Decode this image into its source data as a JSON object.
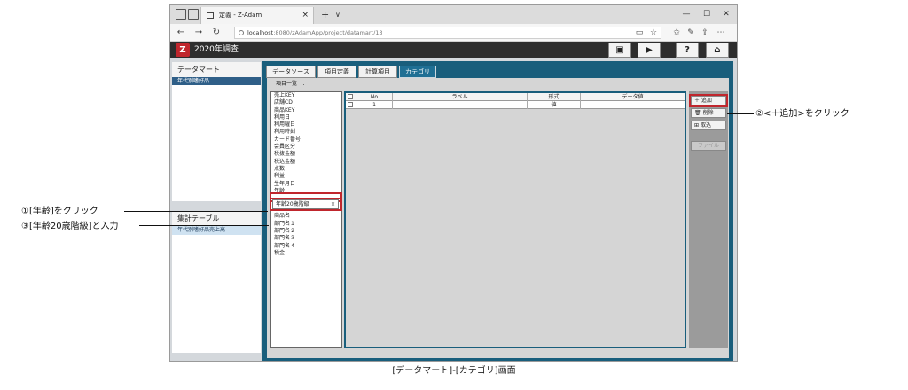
{
  "browser": {
    "tab_title": "定義 - Z-Adam",
    "url_host": "localhost",
    "url_rest": ":8080/zAdamApp/project/datamart/13"
  },
  "app": {
    "title": "2020年調査"
  },
  "left": {
    "datamart_header": "データマート",
    "datamart_selected": "年代別嗜好品",
    "summary_header": "集計テーブル",
    "summary_selected": "年代別嗜好品売上高"
  },
  "tabs": [
    {
      "label": "データソース"
    },
    {
      "label": "項目定義"
    },
    {
      "label": "計算項目"
    },
    {
      "label": "カテゴリ"
    }
  ],
  "content": {
    "list_header": "項目一覧　：",
    "fields": [
      "売上KEY",
      "店舗CD",
      "商品KEY",
      "利用日",
      "利用曜日",
      "利用時刻",
      "カード番号",
      "会員区分",
      "税抜金額",
      "税込金額",
      "点数",
      "利益",
      "生年月日",
      "年齢"
    ],
    "fields_after": [
      "階級",
      "商品名",
      "部門名１",
      "部門名２",
      "部門名３",
      "部門名４",
      "税金"
    ],
    "category_input_value": "年齢20歳階級"
  },
  "grid": {
    "columns": [
      "No",
      "ラベル",
      "形式",
      "データ値"
    ],
    "rows": [
      {
        "no": "1",
        "label": "",
        "format": "値",
        "value": ""
      }
    ]
  },
  "buttons": {
    "add": "＋ 追加",
    "delete": "削除",
    "import": "取込",
    "file": "ファイル"
  },
  "annotations": {
    "step1": "①[年齢]をクリック",
    "step2": "②<＋追加>をクリック",
    "step3": "③[年齢20歳階級]と入力",
    "caption": "[データマート]-[カテゴリ]画面"
  }
}
